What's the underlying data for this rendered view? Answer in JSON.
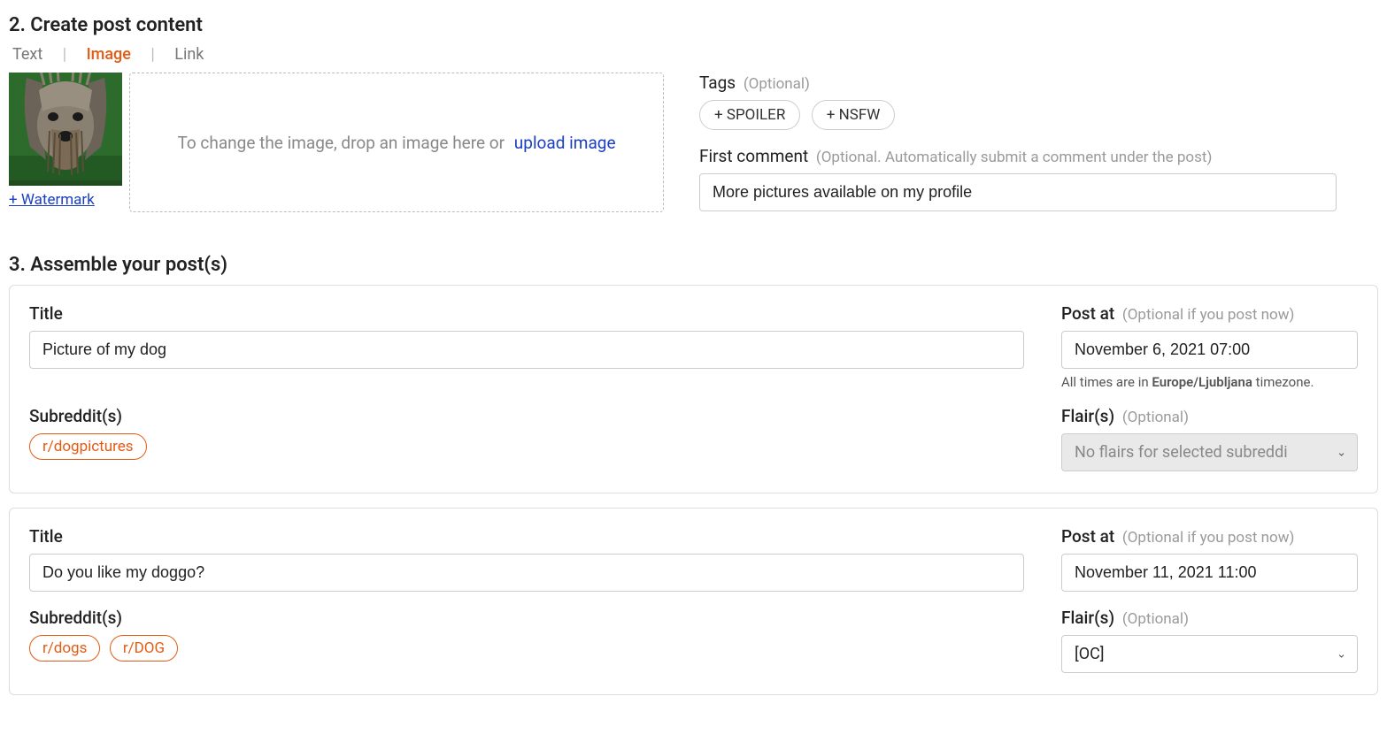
{
  "section2": {
    "heading": "2. Create post content",
    "tabs": {
      "text": "Text",
      "image": "Image",
      "link": "Link"
    },
    "watermark": "+ Watermark",
    "dropzone_text": "To change the image, drop an image here or",
    "upload_link": "upload image"
  },
  "tags": {
    "label": "Tags",
    "optional": "(Optional)",
    "spoiler": "+ SPOILER",
    "nsfw": "+ NSFW"
  },
  "first_comment": {
    "label": "First comment",
    "optional": "(Optional. Automatically submit a comment under the post)",
    "value": "More pictures available on my profile"
  },
  "section3": {
    "heading": "3. Assemble your post(s)"
  },
  "posts": [
    {
      "title_label": "Title",
      "title": "Picture of my dog",
      "subreddit_label": "Subreddit(s)",
      "subreddits": [
        "r/dogpictures"
      ],
      "postat_label": "Post at",
      "postat_optional": "(Optional if you post now)",
      "postat_value": "November 6, 2021 07:00",
      "tz_prefix": "All times are in ",
      "tz_value": "Europe/Ljubljana",
      "tz_suffix": " timezone.",
      "flair_label": "Flair(s)",
      "flair_optional": "(Optional)",
      "flair_text": "No flairs for selected subreddi",
      "flair_enabled": false
    },
    {
      "title_label": "Title",
      "title": "Do you like my doggo?",
      "subreddit_label": "Subreddit(s)",
      "subreddits": [
        "r/dogs",
        "r/DOG"
      ],
      "postat_label": "Post at",
      "postat_optional": "(Optional if you post now)",
      "postat_value": "November 11, 2021 11:00",
      "flair_label": "Flair(s)",
      "flair_optional": "(Optional)",
      "flair_text": "[OC]",
      "flair_enabled": true
    }
  ]
}
